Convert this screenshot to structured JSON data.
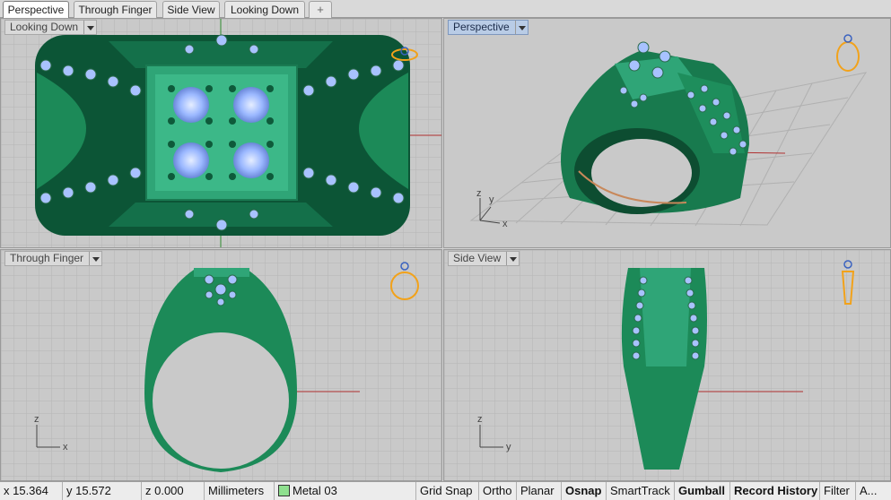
{
  "tabs": [
    {
      "label": "Perspective",
      "active": true
    },
    {
      "label": "Through Finger",
      "active": false
    },
    {
      "label": "Side View",
      "active": false
    },
    {
      "label": "Looking Down",
      "active": false
    },
    {
      "label": "+",
      "icon": "plus-icon"
    }
  ],
  "viewports": {
    "top_left": {
      "label": "Looking Down",
      "active": false
    },
    "top_right": {
      "label": "Perspective",
      "active": true
    },
    "bottom_left": {
      "label": "Through Finger",
      "active": false
    },
    "bottom_right": {
      "label": "Side View",
      "active": false
    }
  },
  "axes": {
    "top_right": {
      "z": "z",
      "y": "y",
      "x": "x"
    },
    "bottom_left": {
      "z": "z",
      "x": "x"
    },
    "bottom_right": {
      "z": "z",
      "y": "y"
    }
  },
  "status": {
    "x": "x 15.364",
    "y": "y 15.572",
    "z": "z 0.000",
    "units": "Millimeters",
    "layer": "Metal 03",
    "layer_color": "#8fe08f",
    "buttons": [
      {
        "label": "Grid Snap",
        "bold": false
      },
      {
        "label": "Ortho",
        "bold": false
      },
      {
        "label": "Planar",
        "bold": false
      },
      {
        "label": "Osnap",
        "bold": true
      },
      {
        "label": "SmartTrack",
        "bold": false
      },
      {
        "label": "Gumball",
        "bold": true
      },
      {
        "label": "Record History",
        "bold": true
      },
      {
        "label": "Filter",
        "bold": false
      },
      {
        "label": "A...",
        "bold": false
      }
    ]
  },
  "colors": {
    "viewport_bg": "#c9c9c9",
    "grid": "#b3b3b3",
    "ring_metal": "#1e8a5a",
    "gem": "#9bb8ff",
    "axis_red": "#b03030",
    "axis_green": "#2e8b2e",
    "active_tab_blue": "#b9cce6",
    "widget_orange": "#f2a21a"
  }
}
